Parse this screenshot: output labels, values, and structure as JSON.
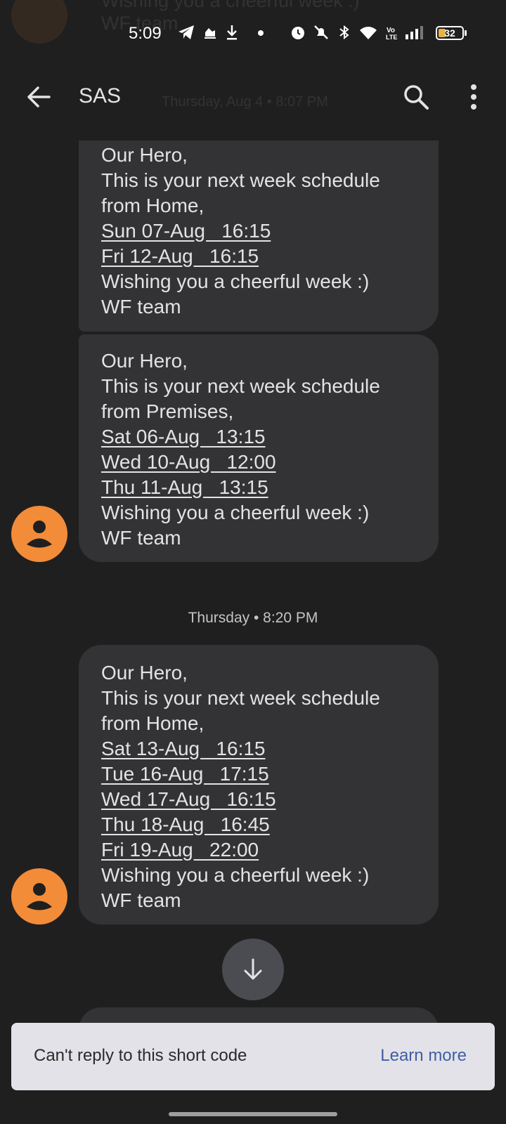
{
  "status_bar": {
    "time": "5:09",
    "battery": "32",
    "battery_level": 0.32,
    "icons": [
      "telegram-icon",
      "cloud-icon",
      "download-icon",
      "dot-icon",
      "alarm-icon",
      "mute-icon",
      "bluetooth-icon",
      "wifi-icon",
      "volte-icon",
      "signal-icon",
      "battery-icon"
    ]
  },
  "header": {
    "title": "SAS",
    "icons": {
      "back": "arrow-back-icon",
      "search": "search-icon",
      "more": "more-vert-icon"
    }
  },
  "ghost": {
    "line1": "Wishing you a cheerful week :)",
    "line2": "WF team",
    "timestamp": "Thursday, Aug 4 • 8:07 PM"
  },
  "messages": [
    {
      "lines": [
        "Our Hero,",
        "This is your next week schedule",
        "from Home,"
      ],
      "schedule": [
        "Sun 07-Aug   16:15",
        "Fri 12-Aug   16:15"
      ],
      "footer": [
        "Wishing you a cheerful week :)",
        "WF team"
      ]
    },
    {
      "lines": [
        "Our Hero,",
        "This is your next week schedule",
        "from Premises,"
      ],
      "schedule": [
        "Sat 06-Aug   13:15",
        "Wed 10-Aug   12:00",
        "Thu 11-Aug   13:15"
      ],
      "footer": [
        "Wishing you a cheerful week :)",
        "WF team"
      ]
    },
    {
      "lines": [
        "Our Hero,",
        "This is your next week schedule",
        "from Home,"
      ],
      "schedule": [
        "Sat 13-Aug   16:15",
        "Tue 16-Aug   17:15",
        "Wed 17-Aug   16:15",
        "Thu 18-Aug   16:45",
        "Fri 19-Aug   22:00"
      ],
      "footer": [
        "Wishing you a cheerful week :)",
        "WF team"
      ]
    }
  ],
  "divider": {
    "timestamp": "Thursday • 8:20 PM"
  },
  "banner": {
    "text": "Can't reply to this short code",
    "link": "Learn more"
  },
  "colors": {
    "background": "#1f1f1f",
    "bubble": "#333335",
    "avatar": "#f28c38",
    "banner_bg": "#e4e2e9",
    "link": "#3e5fa5"
  }
}
